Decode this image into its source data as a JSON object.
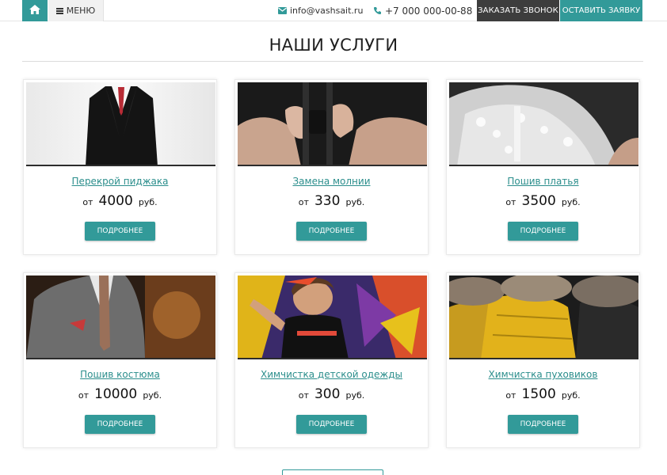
{
  "topbar": {
    "menu_label": "МЕНЮ",
    "email": "info@vashsait.ru",
    "phone": "+7 000 000-00-88",
    "call_button": "ЗАКАЗАТЬ ЗВОНОК",
    "order_button": "ОСТАВИТЬ ЗАЯВКУ",
    "icons": [
      "home-icon",
      "menu-icon",
      "envelope-icon",
      "phone-icon"
    ]
  },
  "colors": {
    "accent": "#329a99",
    "dark": "#3d3d3d",
    "link": "#2b8e8c"
  },
  "section": {
    "title": "НАШИ УСЛУГИ"
  },
  "services": [
    {
      "name": "Перекрой пиджака",
      "prefix": "от",
      "price": "4000",
      "suffix": "руб.",
      "button": "ПОДРОБНЕЕ",
      "image": "black-suit-jacket-photo"
    },
    {
      "name": "Замена молнии",
      "prefix": "от",
      "price": "330",
      "suffix": "руб.",
      "button": "ПОДРОБНЕЕ",
      "image": "zipper-closeup-photo"
    },
    {
      "name": "Пошив платья",
      "prefix": "от",
      "price": "3500",
      "suffix": "руб.",
      "button": "ПОДРОБНЕЕ",
      "image": "lace-dress-photo"
    },
    {
      "name": "Пошив костюма",
      "prefix": "от",
      "price": "10000",
      "suffix": "руб.",
      "button": "ПОДРОБНЕЕ",
      "image": "grey-suit-photo"
    },
    {
      "name": "Химчистка детской одежды",
      "prefix": "от",
      "price": "300",
      "suffix": "руб.",
      "button": "ПОДРОБНЕЕ",
      "image": "child-graffiti-photo"
    },
    {
      "name": "Химчистка пуховиков",
      "prefix": "от",
      "price": "1500",
      "suffix": "руб.",
      "button": "ПОДРОБНЕЕ",
      "image": "down-jackets-photo"
    }
  ]
}
